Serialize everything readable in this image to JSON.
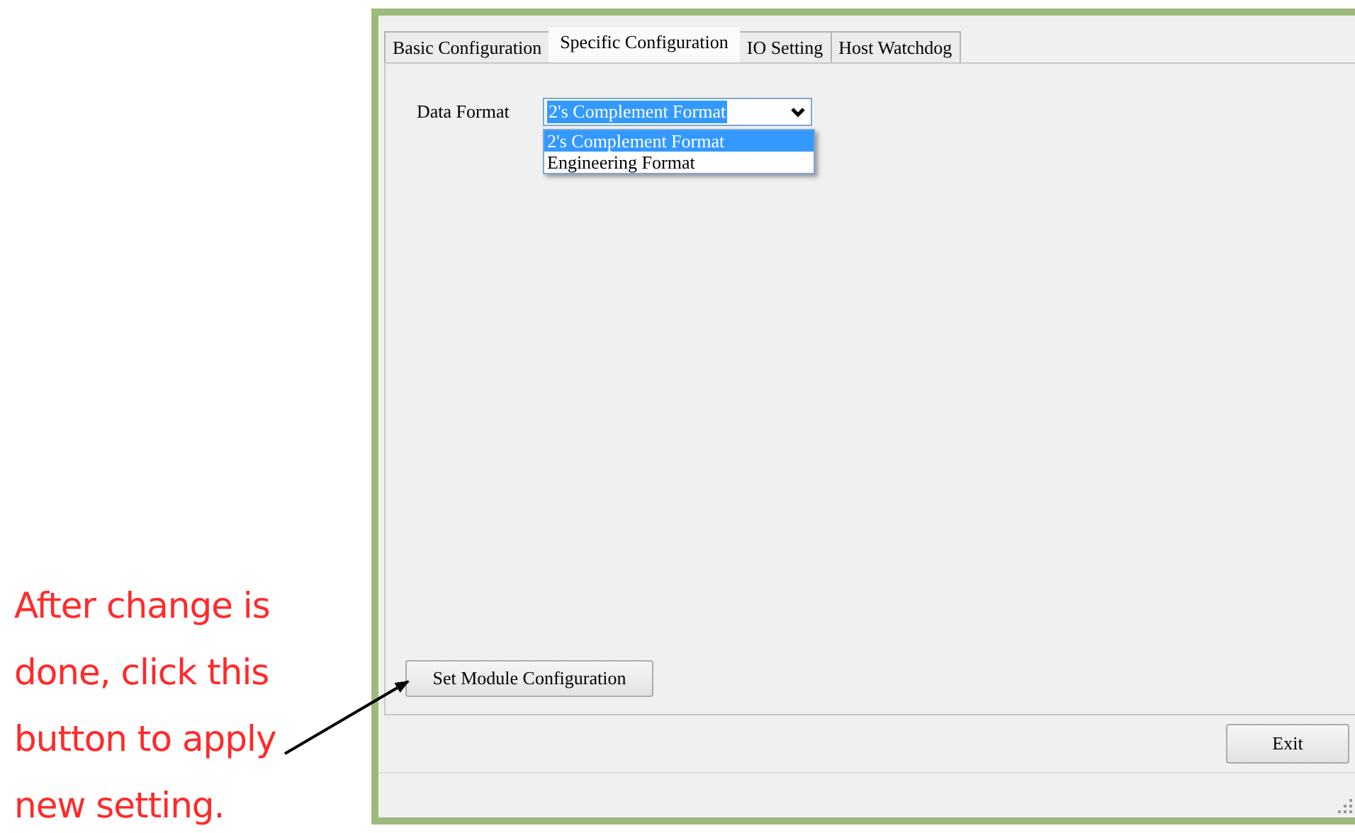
{
  "annotation": {
    "lines": [
      "After change is",
      "done, click this",
      "button to apply",
      "new setting."
    ]
  },
  "window": {
    "tabs": [
      {
        "label": "Basic Configuration",
        "selected": false
      },
      {
        "label": "Specific Configuration",
        "selected": true
      },
      {
        "label": "IO Setting",
        "selected": false
      },
      {
        "label": "Host Watchdog",
        "selected": false
      }
    ],
    "data_format": {
      "label": "Data Format",
      "value": "2's Complement Format",
      "expanded": true,
      "options": [
        {
          "label": "2's Complement Format",
          "selected": true
        },
        {
          "label": "Engineering Format",
          "selected": false
        }
      ]
    },
    "set_button": "Set Module Configuration",
    "exit_button": "Exit"
  }
}
